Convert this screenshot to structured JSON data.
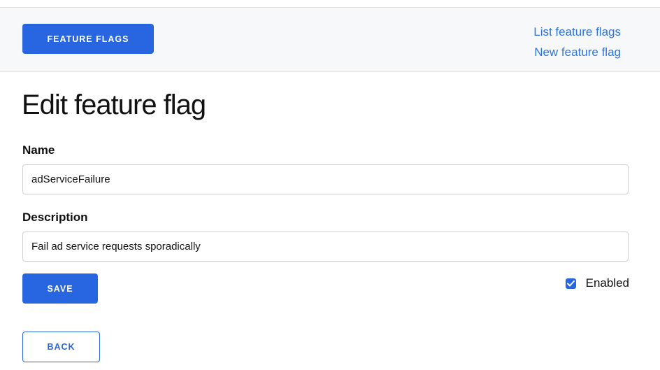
{
  "header": {
    "feature_flags_button": "FEATURE FLAGS",
    "links": {
      "list": "List feature flags",
      "new": "New feature flag"
    }
  },
  "form": {
    "title": "Edit feature flag",
    "name_label": "Name",
    "name_value": "adServiceFailure",
    "description_label": "Description",
    "description_value": "Fail ad service requests sporadically",
    "save_label": "SAVE",
    "enabled_label": "Enabled",
    "enabled_checked": true,
    "back_label": "BACK"
  },
  "colors": {
    "accent": "#2766e0",
    "link": "#2f74d8",
    "header_bg": "#f7f8fa"
  }
}
